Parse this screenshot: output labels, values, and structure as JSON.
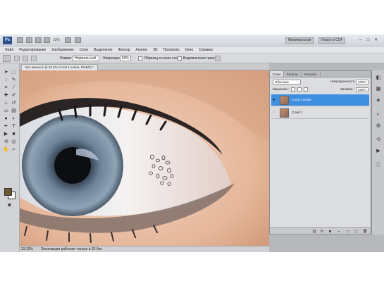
{
  "window": {
    "logo": "Ps",
    "zoom": "33%",
    "workspace_basic": "Минимальная",
    "workspace_new": "Новое в CS4"
  },
  "menu": [
    "Файл",
    "Редактирование",
    "Изображение",
    "Слои",
    "Выделение",
    "Фильтр",
    "Анализ",
    "3D",
    "Просмотр",
    "Окно",
    "Справка"
  ],
  "options": {
    "mode_label": "Режим:",
    "mode_value": "Нормальный",
    "opacity_label": "Непрозрачность:",
    "opacity_value": "50%",
    "sample_label": "Образец со всех слоев",
    "aligned_label": "Выровненная граница"
  },
  "document": {
    "tab_title": "Без имени-1 @ 33.3% (Слой 1 копия, RGB/8) *",
    "status_zoom": "33.33%",
    "status_info": "Экспозиция работает только в 32-бит"
  },
  "layers_panel": {
    "tabs": [
      "Слои",
      "Каналы",
      "Контуры"
    ],
    "blend_mode": "Обычные",
    "opacity_label": "Непрозрачность:",
    "opacity_value": "100%",
    "lock_label": "Закрепить:",
    "fill_label": "Заливка:",
    "fill_value": "100%",
    "layers": [
      {
        "name": "Слой 1 копия",
        "selected": true,
        "visible": true
      },
      {
        "name": "Слой 1",
        "selected": false,
        "visible": false
      }
    ]
  },
  "colors": {
    "foreground": "#6d5a2a",
    "background": "#ffffff",
    "selection": "#3f8fe0"
  }
}
